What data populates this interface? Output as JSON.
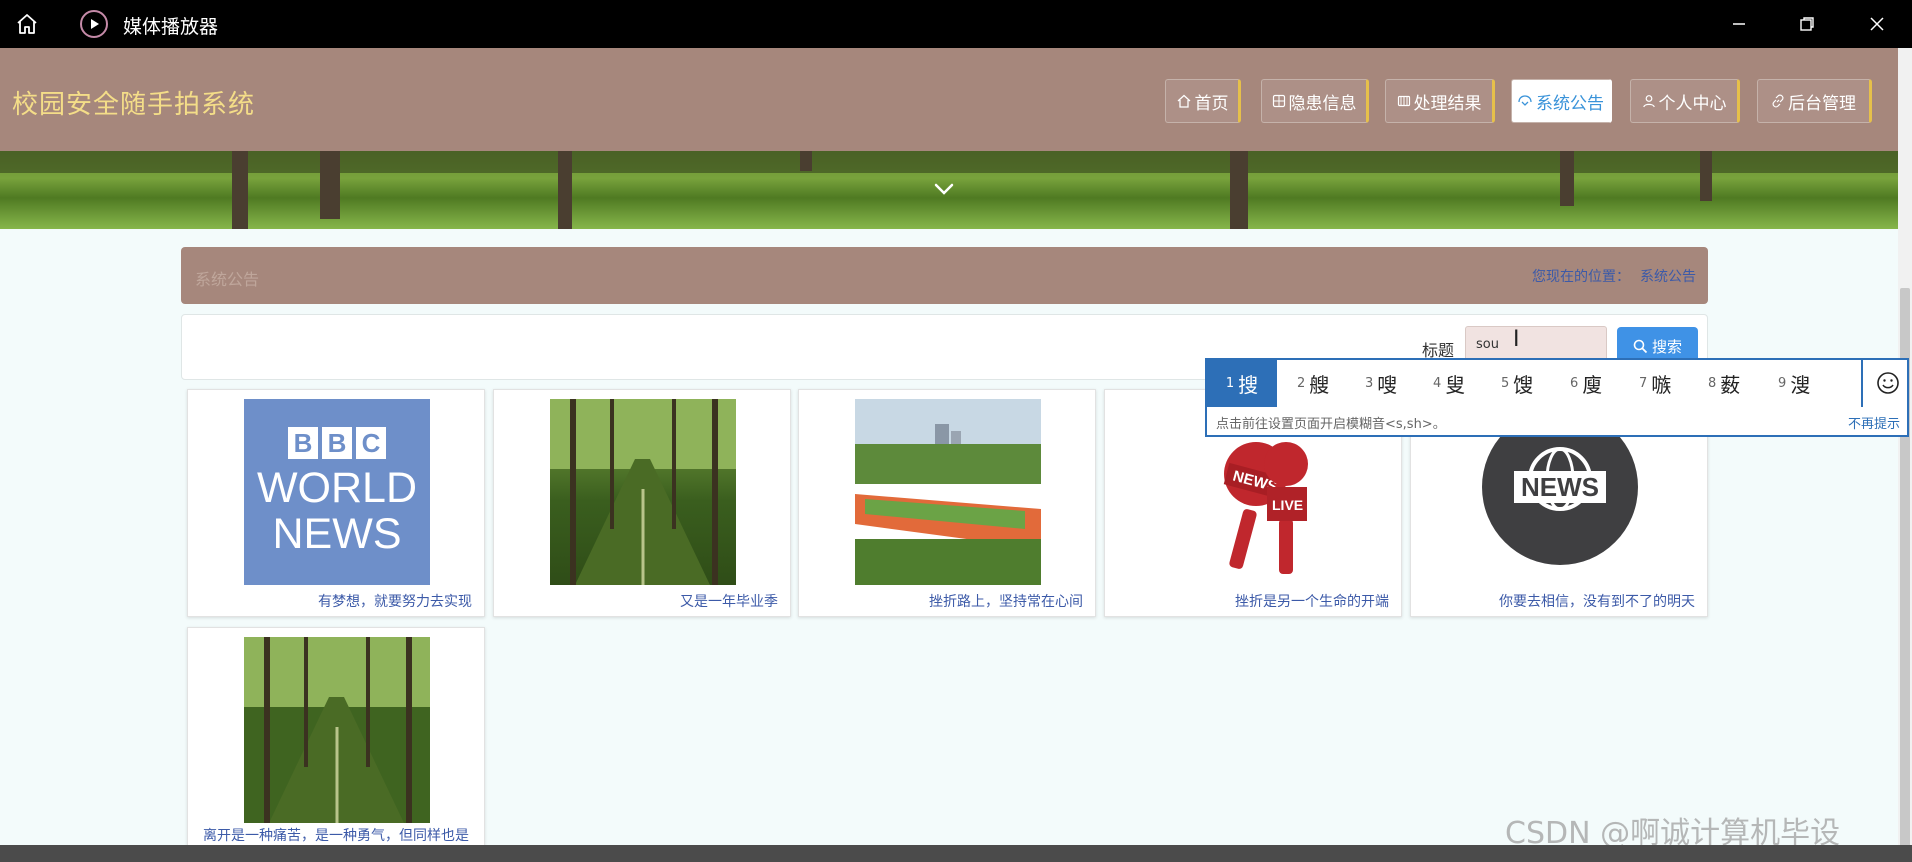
{
  "player": {
    "title": "媒体播放器",
    "icons": [
      "home-icon",
      "play-icon",
      "minimize-icon",
      "restore-icon",
      "close-icon"
    ]
  },
  "site": {
    "title": "校园安全随手拍系统",
    "nav": [
      {
        "label": "首页",
        "icon": "home-icon"
      },
      {
        "label": "隐患信息",
        "icon": "grid-icon"
      },
      {
        "label": "处理结果",
        "icon": "list-icon"
      },
      {
        "label": "系统公告",
        "icon": "announcement-icon",
        "active": true
      },
      {
        "label": "个人中心",
        "icon": "user-icon"
      },
      {
        "label": "后台管理",
        "icon": "link-icon"
      }
    ]
  },
  "breadcrumb": {
    "title": "系统公告",
    "location_label": "您现在的位置：",
    "location_value": "系统公告"
  },
  "search": {
    "label": "标题",
    "value": "sou",
    "button_label": "搜索"
  },
  "ime": {
    "candidates": [
      {
        "num": "1",
        "char": "搜"
      },
      {
        "num": "2",
        "char": "艘"
      },
      {
        "num": "3",
        "char": "嗖"
      },
      {
        "num": "4",
        "char": "叟"
      },
      {
        "num": "5",
        "char": "馊"
      },
      {
        "num": "6",
        "char": "廋"
      },
      {
        "num": "7",
        "char": "嗾"
      },
      {
        "num": "8",
        "char": "薮"
      },
      {
        "num": "9",
        "char": "溲"
      }
    ],
    "tip": "点击前往设置页面开启模糊音<s,sh>。",
    "dismiss": "不再提示"
  },
  "cards": [
    {
      "caption": "有梦想，就要努力去实现",
      "image": "bbc-world-news-logo",
      "bbc": [
        "B",
        "B",
        "C"
      ],
      "line1": "WORLD",
      "line2": "NEWS"
    },
    {
      "caption": "又是一年毕业季",
      "image": "tree-lined-path"
    },
    {
      "caption": "挫折路上，坚持常在心间",
      "image": "campus-sports-field"
    },
    {
      "caption": "挫折是另一个生命的开端",
      "image": "news-microphones",
      "mic_labels": [
        "NEWS",
        "LIVE"
      ]
    },
    {
      "caption": "你要去相信，没有到不了的明天",
      "image": "news-globe-badge",
      "badge_text": "NEWS"
    },
    {
      "caption": "离开是一种痛苦，是一种勇气，但同样也是一个考验，是一个新的开端",
      "image": "tree-lined-path"
    }
  ],
  "watermark": "CSDN @啊诚计算机毕设"
}
